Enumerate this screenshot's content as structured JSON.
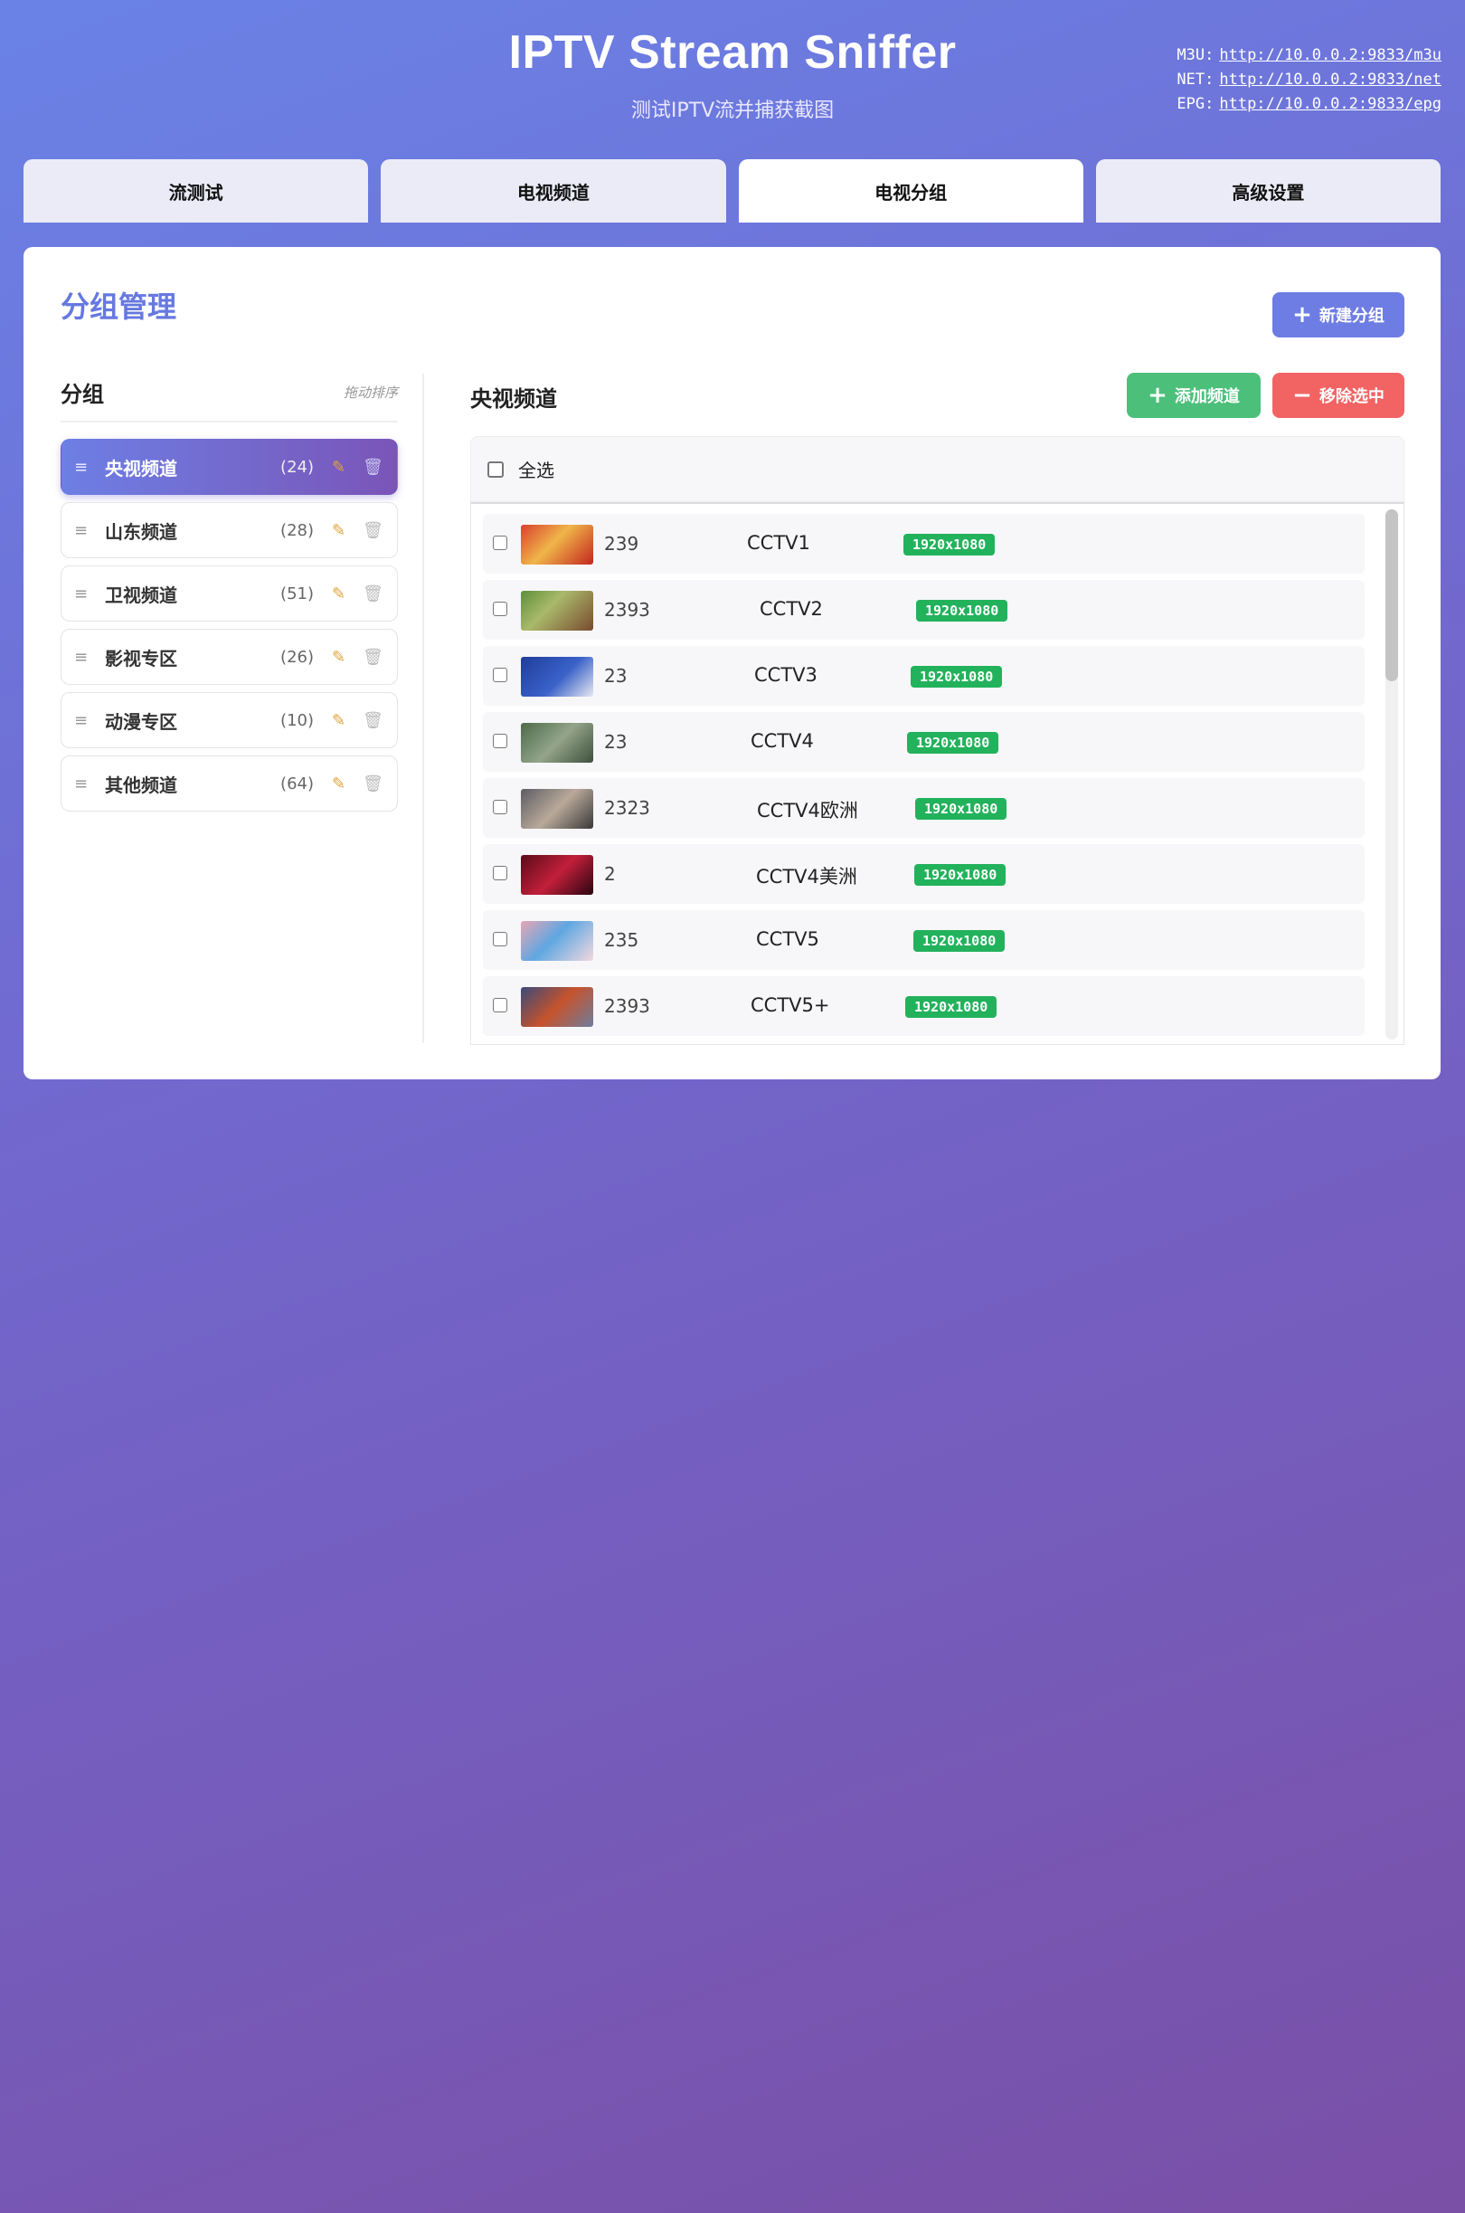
{
  "header": {
    "title": "IPTV Stream Sniffer",
    "subtitle": "测试IPTV流并捕获截图",
    "urls": [
      {
        "label": "M3U:",
        "url": "http://10.0.0.2:9833/m3u"
      },
      {
        "label": "NET:",
        "url": "http://10.0.0.2:9833/net"
      },
      {
        "label": "EPG:",
        "url": "http://10.0.0.2:9833/epg"
      }
    ]
  },
  "tabs": [
    {
      "label": "流测试",
      "active": false
    },
    {
      "label": "电视频道",
      "active": false
    },
    {
      "label": "电视分组",
      "active": true
    },
    {
      "label": "高级设置",
      "active": false
    }
  ],
  "card": {
    "title": "分组管理",
    "new_group_button": "新建分组"
  },
  "groups_panel": {
    "title": "分组",
    "hint": "拖动排序",
    "items": [
      {
        "name": "央视频道",
        "count": "(24)",
        "active": true
      },
      {
        "name": "山东频道",
        "count": "(28)",
        "active": false
      },
      {
        "name": "卫视频道",
        "count": "(51)",
        "active": false
      },
      {
        "name": "影视专区",
        "count": "(26)",
        "active": false
      },
      {
        "name": "动漫专区",
        "count": "(10)",
        "active": false
      },
      {
        "name": "其他频道",
        "count": "(64)",
        "active": false
      }
    ]
  },
  "channels_panel": {
    "title": "央视频道",
    "add_button": "添加频道",
    "remove_button": "移除选中",
    "select_all": "全选",
    "channels": [
      {
        "id": "239",
        "name": "CCTV1",
        "resolution": "1920x1080"
      },
      {
        "id": "2393",
        "name": "CCTV2",
        "resolution": "1920x1080"
      },
      {
        "id": "23",
        "name": "CCTV3",
        "resolution": "1920x1080"
      },
      {
        "id": "23",
        "name": "CCTV4",
        "resolution": "1920x1080"
      },
      {
        "id": "2323",
        "name": "CCTV4欧洲",
        "resolution": "1920x1080"
      },
      {
        "id": "2",
        "name": "CCTV4美洲",
        "resolution": "1920x1080"
      },
      {
        "id": "235",
        "name": "CCTV5",
        "resolution": "1920x1080"
      },
      {
        "id": "2393",
        "name": "CCTV5+",
        "resolution": "1920x1080"
      }
    ]
  },
  "colors": {
    "accent": "#6e7de3",
    "add_button": "#4cc07a",
    "remove_button": "#f26363",
    "resolution_badge": "#23b25c",
    "active_group_gradient": [
      "#6d7fe4",
      "#7a55b8"
    ]
  },
  "icons": {
    "drag_handle": "drag-handle-icon",
    "edit": "pencil-icon",
    "delete": "trash-icon",
    "plus": "plus-icon",
    "minus": "minus-icon"
  }
}
